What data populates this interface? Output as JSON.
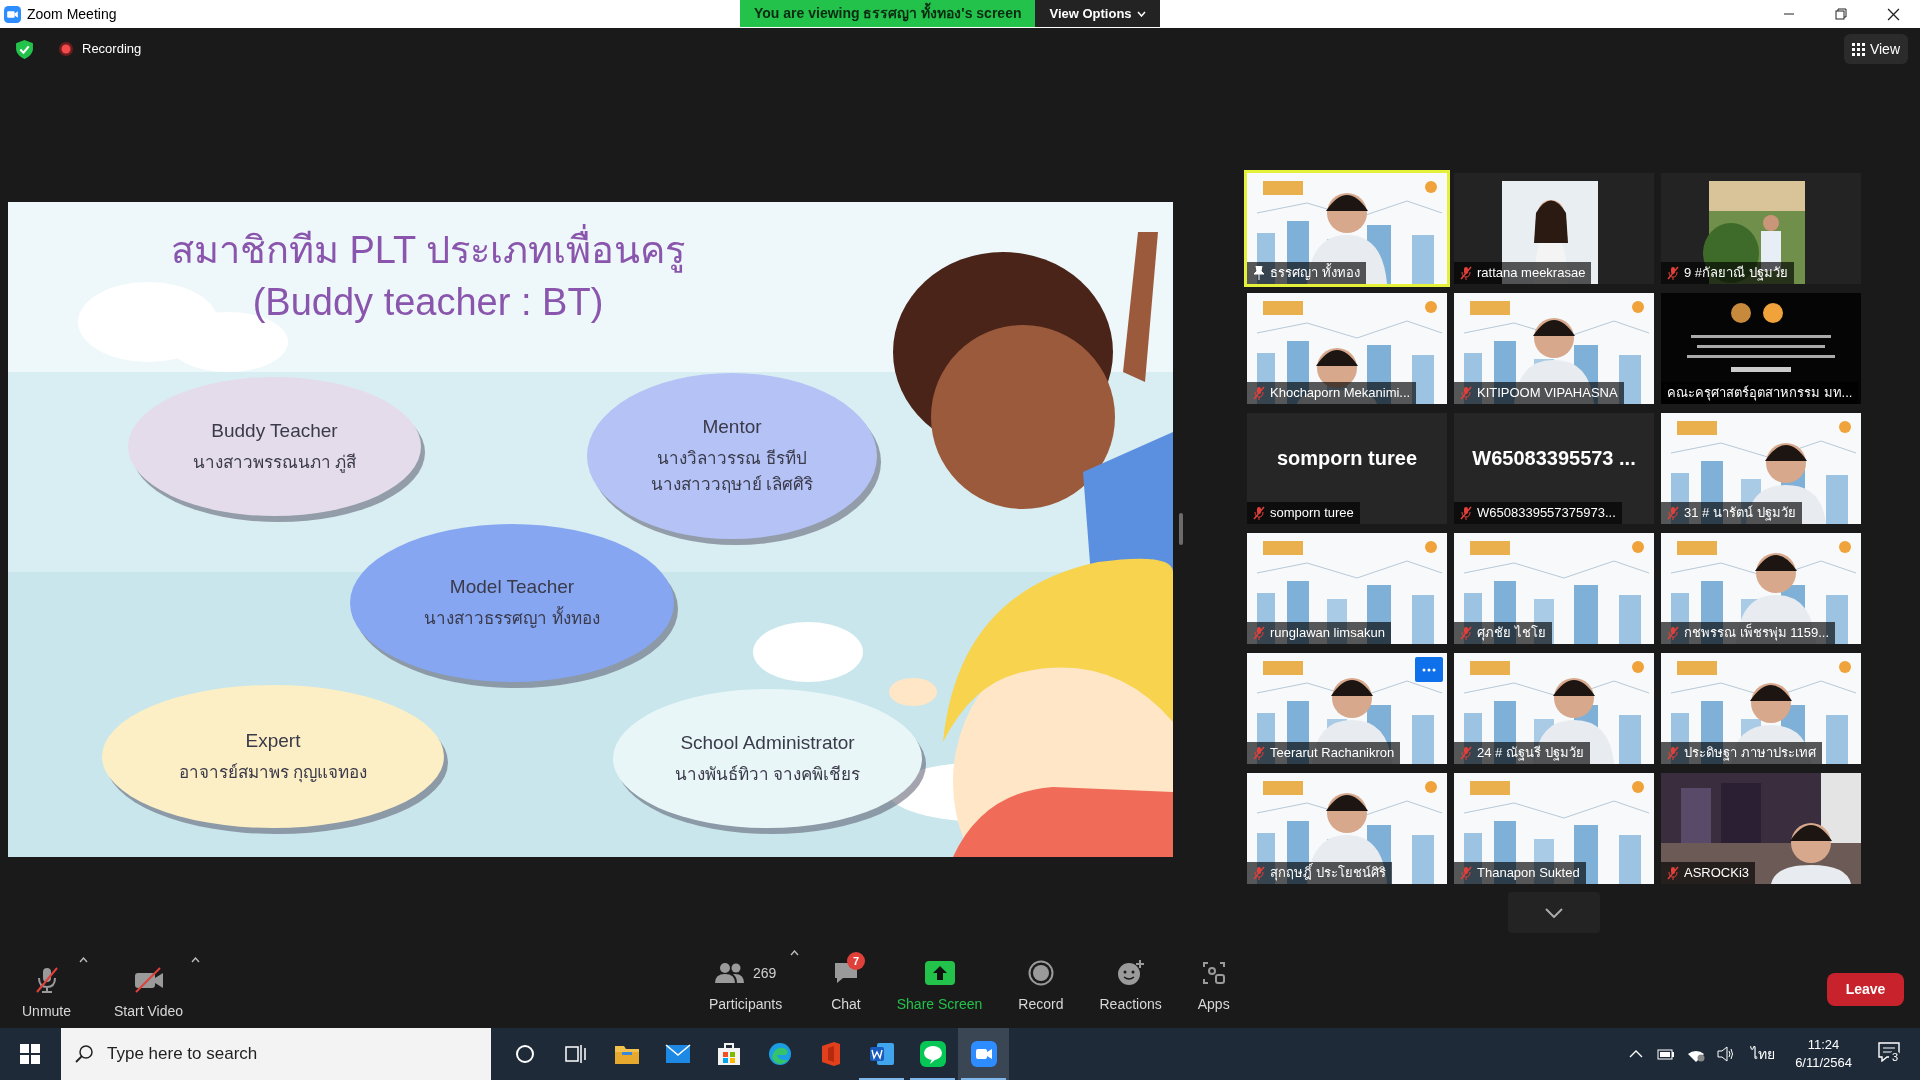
{
  "window": {
    "title": "Zoom Meeting"
  },
  "share_banner": {
    "text": "You are viewing ธรรศญา ทั้งทอง's screen",
    "view_options": "View Options"
  },
  "meeting_bar": {
    "recording": "Recording",
    "view": "View"
  },
  "slide": {
    "title_lines": [
      "สมาชิกทีม PLT ประเภทเพื่อนครู",
      "(Buddy teacher : BT)"
    ],
    "bubbles": [
      {
        "role": "Buddy Teacher",
        "members": [
          "นางสาวพรรณนภา  ภู่สี"
        ],
        "color": "#e4dcea"
      },
      {
        "role": "Mentor",
        "members": [
          "นางวิลาวรรณ  ธีรทีป",
          "นางสาววฤษาย์  เลิศศิริ"
        ],
        "color": "#b4c2f6"
      },
      {
        "role": "Model Teacher",
        "members": [
          "นางสาวธรรศญา  ทั้งทอง"
        ],
        "color": "#86a6f2"
      },
      {
        "role": "Expert",
        "members": [
          "อาจารย์สมาพร  กุญแจทอง"
        ],
        "color": "#fcefc6"
      },
      {
        "role": "School Administrator",
        "members": [
          "นางพันธ์ทิวา จางคพิเชียร"
        ],
        "color": "#e8f6f7"
      }
    ]
  },
  "participants": [
    {
      "name": "ธรรศญา ทั้งทอง",
      "kind": "video",
      "speaking": true,
      "pinned": true,
      "muted": false,
      "hovered": false
    },
    {
      "name": "rattana meekrasae",
      "kind": "video",
      "speaking": false,
      "pinned": false,
      "muted": true,
      "hovered": false
    },
    {
      "name": "9 #กัลยาณี ปฐมวัย",
      "kind": "video",
      "speaking": false,
      "pinned": false,
      "muted": true,
      "hovered": false
    },
    {
      "name": "Khochaporn Mekanimi...",
      "kind": "video",
      "speaking": false,
      "pinned": false,
      "muted": true,
      "hovered": false
    },
    {
      "name": "KITIPOOM VIPAHASNA",
      "kind": "video",
      "speaking": false,
      "pinned": false,
      "muted": true,
      "hovered": false
    },
    {
      "name": "คณะครุศาสตร์อุตสาหกรรม มท...",
      "kind": "video",
      "speaking": false,
      "pinned": false,
      "muted": false,
      "hovered": false
    },
    {
      "name": "somporn turee",
      "kind": "name_only",
      "display": "somporn turee",
      "speaking": false,
      "pinned": false,
      "muted": true,
      "hovered": false
    },
    {
      "name": "W6508339557375973...",
      "kind": "name_only",
      "display": "W65083395573 ...",
      "speaking": false,
      "pinned": false,
      "muted": true,
      "hovered": false
    },
    {
      "name": "31 # นารัตน์ ปฐมวัย",
      "kind": "video",
      "speaking": false,
      "pinned": false,
      "muted": true,
      "hovered": false
    },
    {
      "name": "runglawan limsakun",
      "kind": "video",
      "speaking": false,
      "pinned": false,
      "muted": true,
      "hovered": false
    },
    {
      "name": "ศุภชัย ไชโย",
      "kind": "video",
      "speaking": false,
      "pinned": false,
      "muted": true,
      "hovered": false
    },
    {
      "name": "กชพรรณ เพ็ชรพุ่ม 1159...",
      "kind": "video",
      "speaking": false,
      "pinned": false,
      "muted": true,
      "hovered": false
    },
    {
      "name": "Teerarut Rachanikron",
      "kind": "video",
      "speaking": false,
      "pinned": false,
      "muted": true,
      "hovered": true
    },
    {
      "name": "24 # ณัฐนรี ปฐมวัย",
      "kind": "video",
      "speaking": false,
      "pinned": false,
      "muted": true,
      "hovered": false
    },
    {
      "name": "ประดิษฐา ภาษาประเทศ",
      "kind": "video",
      "speaking": false,
      "pinned": false,
      "muted": true,
      "hovered": false
    },
    {
      "name": "สุกฤษฎิ์ ประโยชน์ศิริ",
      "kind": "video",
      "speaking": false,
      "pinned": false,
      "muted": true,
      "hovered": false
    },
    {
      "name": "Thanapon Sukted",
      "kind": "video",
      "speaking": false,
      "pinned": false,
      "muted": true,
      "hovered": false
    },
    {
      "name": "ASROCKi3",
      "kind": "video",
      "speaking": false,
      "pinned": false,
      "muted": true,
      "hovered": false
    }
  ],
  "toolbar": {
    "left": [
      {
        "label": "Unmute",
        "kind": "mic_off"
      },
      {
        "label": "Start Video",
        "kind": "video_off"
      }
    ],
    "center": [
      {
        "label": "Participants",
        "kind": "participants",
        "count": "269"
      },
      {
        "label": "Chat",
        "kind": "chat",
        "badge": "7"
      },
      {
        "label": "Share Screen",
        "kind": "share"
      },
      {
        "label": "Record",
        "kind": "record"
      },
      {
        "label": "Reactions",
        "kind": "reactions"
      },
      {
        "label": "Apps",
        "kind": "apps"
      }
    ],
    "leave": "Leave"
  },
  "taskbar": {
    "search_placeholder": "Type here to search",
    "apps": [
      {
        "kind": "cortana",
        "open": false,
        "selected": false
      },
      {
        "kind": "task_view",
        "open": false,
        "selected": false
      },
      {
        "kind": "explorer",
        "open": false,
        "selected": false
      },
      {
        "kind": "mail",
        "open": false,
        "selected": false
      },
      {
        "kind": "store",
        "open": false,
        "selected": false
      },
      {
        "kind": "edge",
        "open": false,
        "selected": false
      },
      {
        "kind": "office",
        "open": false,
        "selected": false
      },
      {
        "kind": "word",
        "open": true,
        "selected": false
      },
      {
        "kind": "line",
        "open": true,
        "selected": false
      },
      {
        "kind": "zoom",
        "open": true,
        "selected": true
      }
    ],
    "language": "ไทย",
    "time": "11:24",
    "date": "6/11/2564",
    "notifications": "3"
  }
}
